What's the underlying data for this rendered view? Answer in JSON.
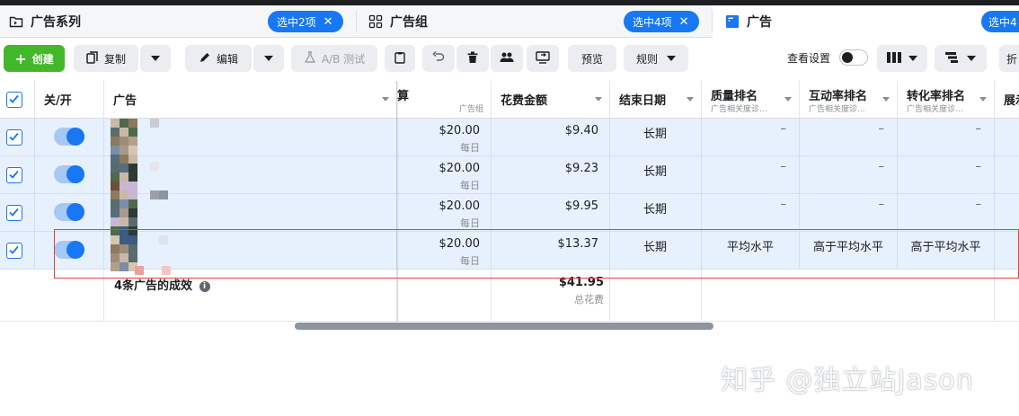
{
  "tabs": {
    "campaigns": {
      "label": "广告系列",
      "selection": "选中2项"
    },
    "adsets": {
      "label": "广告组",
      "selection": "选中4项"
    },
    "ads": {
      "label": "广告",
      "selection": "选中4"
    }
  },
  "toolbar": {
    "create": "创建",
    "duplicate": "复制",
    "edit": "编辑",
    "ab_test": "A/B 测试",
    "preview": "预览",
    "rules": "规则",
    "view_settings": "查看设置",
    "cut_off": "折"
  },
  "table": {
    "headers": {
      "on_off": "关/开",
      "ad": "广告",
      "budget": "预算",
      "budget_sub": "广告组",
      "amount_spent": "花费金额",
      "end_date": "结束日期",
      "quality_ranking": "质量排名",
      "quality_sub": "广告相关度诊...",
      "engagement_ranking": "互动率排名",
      "engagement_sub": "广告相关度诊...",
      "conversion_ranking": "转化率排名",
      "conversion_sub": "广告相关度诊...",
      "impressions_cut": "展示"
    },
    "rows": [
      {
        "budget": "$20.00",
        "budget_period": "每日",
        "spent": "$9.40",
        "end": "长期",
        "quality": "–",
        "engagement": "–",
        "conversion": "–"
      },
      {
        "budget": "$20.00",
        "budget_period": "每日",
        "spent": "$9.23",
        "end": "长期",
        "quality": "–",
        "engagement": "–",
        "conversion": "–"
      },
      {
        "budget": "$20.00",
        "budget_period": "每日",
        "spent": "$9.95",
        "end": "长期",
        "quality": "–",
        "engagement": "–",
        "conversion": "–"
      },
      {
        "budget": "$20.00",
        "budget_period": "每日",
        "spent": "$13.37",
        "end": "长期",
        "quality": "平均水平",
        "engagement": "高于平均水平",
        "conversion": "高于平均水平"
      }
    ],
    "summary": {
      "title": "4条广告的成效",
      "total_spent": "$41.95",
      "total_label": "总花费"
    }
  },
  "watermark": "知乎 @独立站Jason",
  "colors": {
    "accent": "#1877f2",
    "create_green": "#42b72a",
    "selected_row": "#e7f0fd",
    "highlight_red": "#e0453a"
  }
}
